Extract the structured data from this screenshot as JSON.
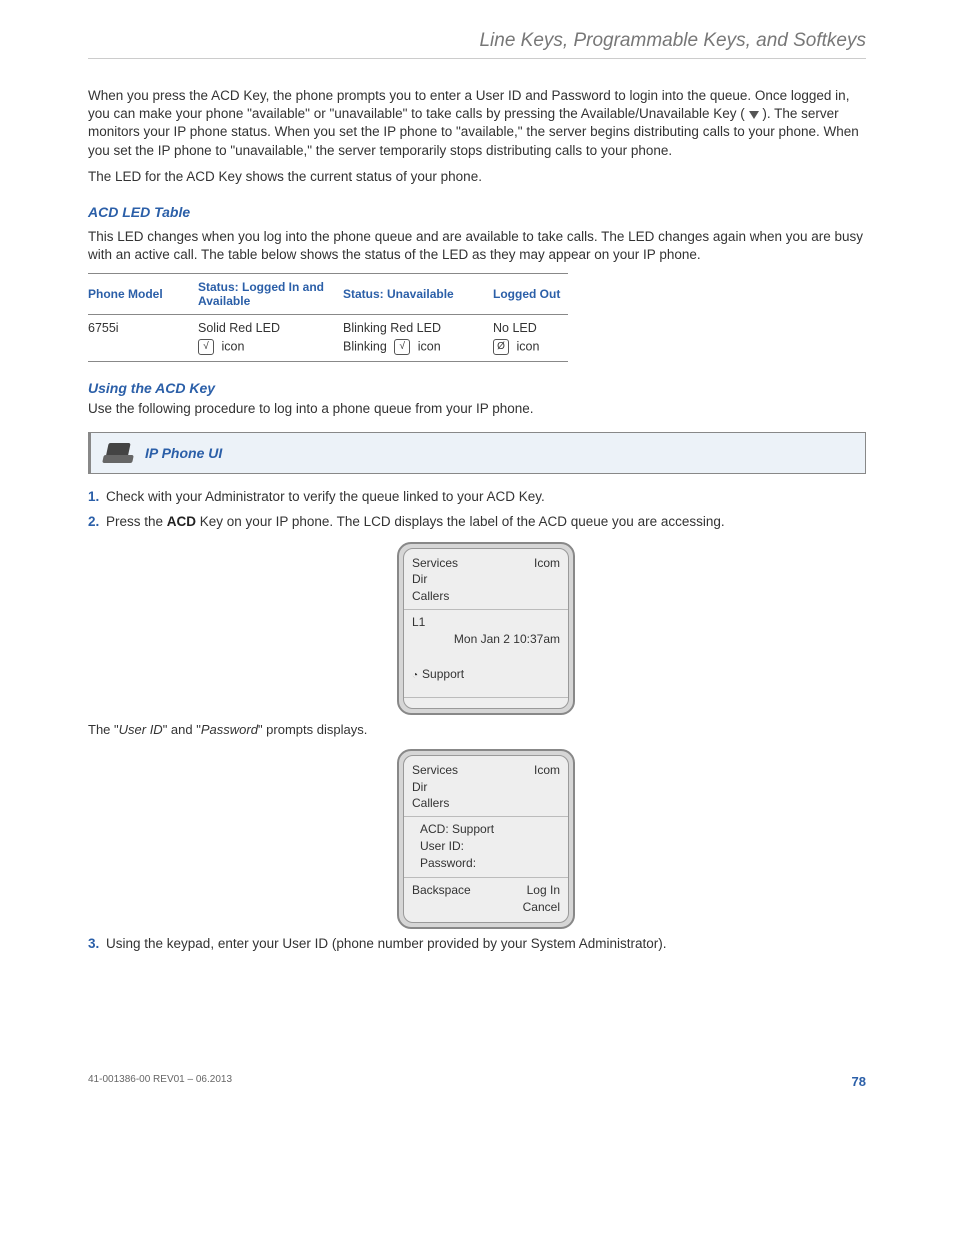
{
  "header": {
    "title": "Line Keys, Programmable Keys, and Softkeys"
  },
  "intro": {
    "p1a": "When you press the ACD Key, the phone prompts you to enter a User ID and Password to login into the queue. Once logged in, you can make your phone \"available\" or \"unavailable\" to take calls by pressing the Available/Unavailable Key ( ",
    "p1b": " ). The server monitors your IP phone status. When you set the IP phone to \"available,\" the server begins distributing calls to your phone. When you set the IP phone to \"unavailable,\" the server temporarily stops distributing calls to your phone.",
    "p2": "The LED for the ACD Key shows the current status of your phone."
  },
  "acd_table": {
    "heading": "ACD LED Table",
    "desc": "This LED changes when you log into the phone queue and are available to take calls. The LED changes again when you are busy with an active call. The table below shows the status of the LED as they may appear on your IP phone.",
    "headers": [
      "Phone Model",
      "Status: Logged In and Available",
      "Status: Unavailable",
      "Logged Out"
    ],
    "row": {
      "model": "6755i",
      "c1": "Solid Red LED",
      "c1b": "icon",
      "c2": "Blinking Red LED",
      "c2b_pre": "Blinking",
      "c2b": "icon",
      "c3": "No LED",
      "c3b": "icon"
    }
  },
  "using": {
    "heading": "Using the ACD Key",
    "desc": "Use the following procedure to log into a phone queue from your IP phone."
  },
  "uibox": {
    "label": "IP Phone UI"
  },
  "steps": {
    "s1": "Check with your Administrator to verify the queue linked to your ACD Key.",
    "s2a": "Press the ",
    "s2b": "ACD",
    "s2c": " Key on your IP phone. The LCD displays the label of the ACD queue you are accessing.",
    "caption_a": "The \"",
    "caption_b": "User ID",
    "caption_c": "\" and \"",
    "caption_d": "Password",
    "caption_e": "\" prompts displays.",
    "s3": "Using the keypad, enter your User ID (phone number provided by your System Administrator)."
  },
  "lcd1": {
    "l1": "Services",
    "l1r": "Icom",
    "l2": "Dir",
    "l3": "Callers",
    "line": "L1",
    "time": "Mon Jan 2 10:37am",
    "support": "Support"
  },
  "lcd2": {
    "l1": "Services",
    "l1r": "Icom",
    "l2": "Dir",
    "l3": "Callers",
    "acd": "ACD: Support",
    "uid": "User ID:",
    "pwd": "Password:",
    "bs": "Backspace",
    "login": "Log In",
    "cancel": "Cancel"
  },
  "footer": {
    "rev": "41-001386-00 REV01 – 06.2013",
    "page": "78"
  }
}
